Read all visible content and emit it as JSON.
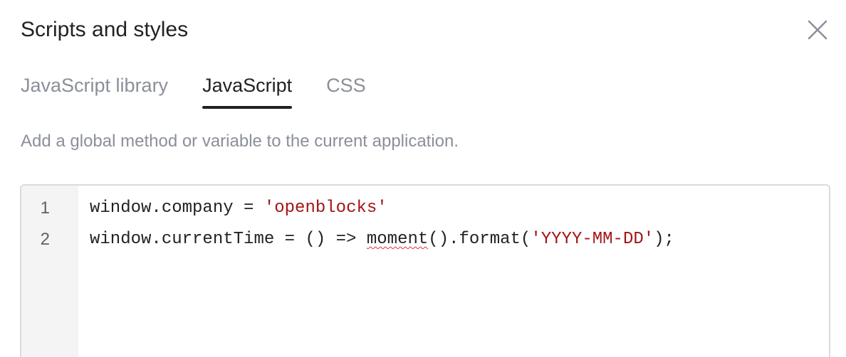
{
  "dialog": {
    "title": "Scripts and styles",
    "close_icon": "close-icon"
  },
  "tabs": [
    {
      "label": "JavaScript library",
      "active": false
    },
    {
      "label": "JavaScript",
      "active": true
    },
    {
      "label": "CSS",
      "active": false
    }
  ],
  "description": "Add a global method or variable to the current application.",
  "editor": {
    "lines": [
      {
        "number": "1",
        "code_prefix": "window.company = ",
        "string": "'openblocks'"
      },
      {
        "number": "2",
        "code_prefix": "window.currentTime = () => ",
        "flagged": "moment",
        "code_middle": "().format(",
        "string": "'YYYY-MM-DD'",
        "code_suffix": ");"
      }
    ]
  },
  "colors": {
    "accent": "#222222",
    "muted_text": "#8b8f9a",
    "string": "#a31515",
    "gutter_bg": "#f4f4f5",
    "border": "#d8dbe0"
  }
}
